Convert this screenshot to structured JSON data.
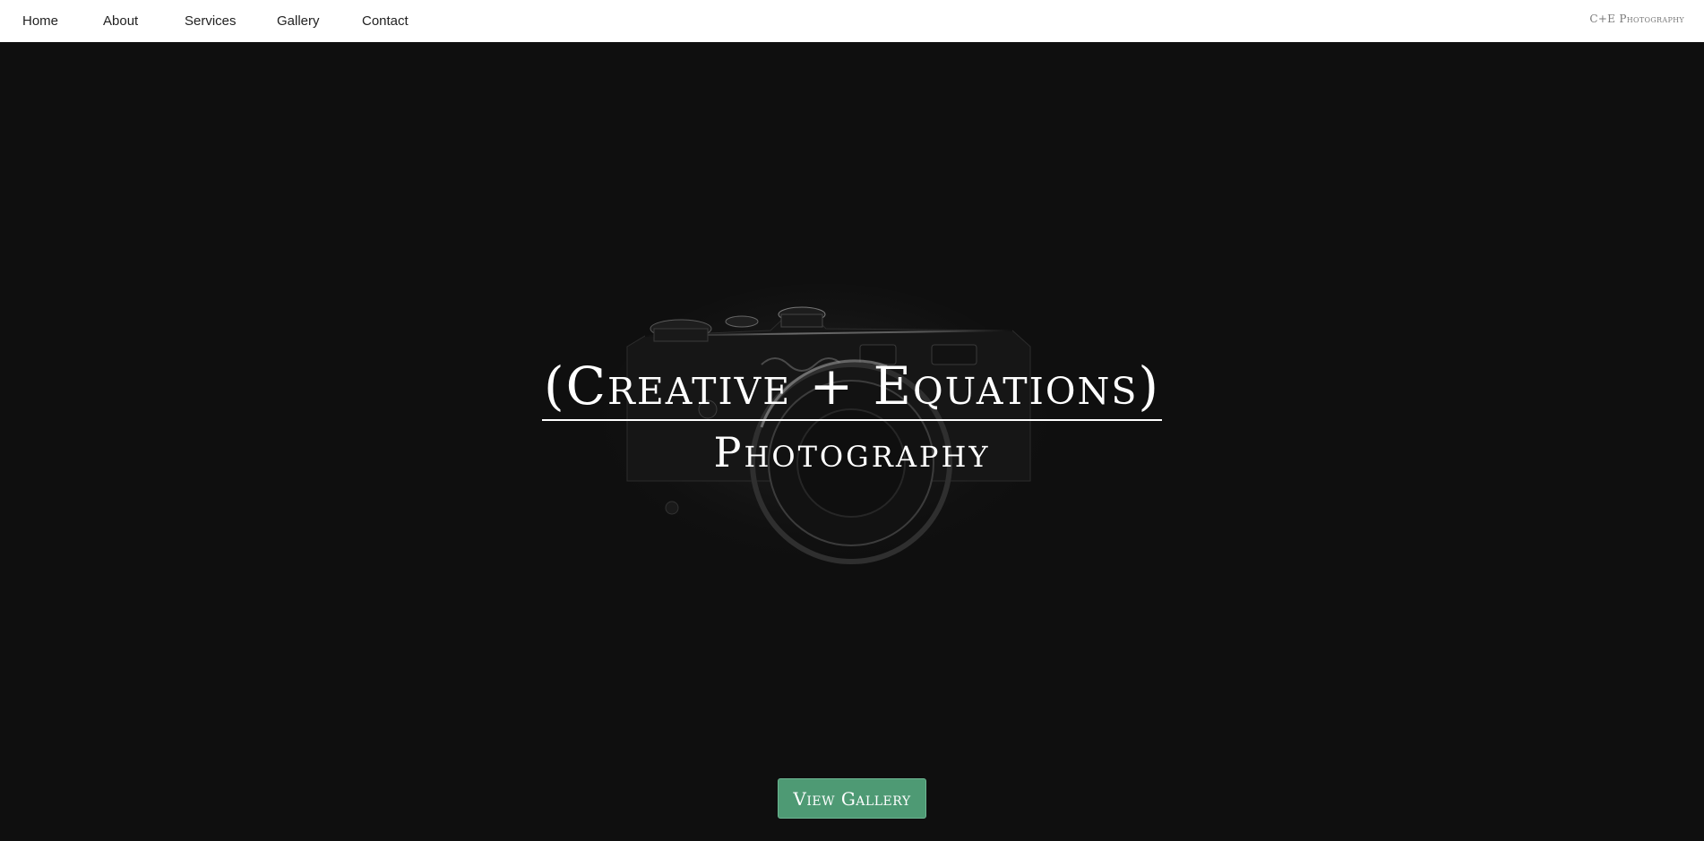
{
  "nav": {
    "links": [
      {
        "label": "Home"
      },
      {
        "label": "About"
      },
      {
        "label": "Services"
      },
      {
        "label": "Gallery"
      },
      {
        "label": "Contact"
      }
    ],
    "brand": "C+E Photography"
  },
  "hero": {
    "title": "(Creative + Equations)",
    "subtitle": "Photography",
    "background_image": "camera-photo"
  },
  "cta": {
    "label": "View Gallery"
  },
  "colors": {
    "nav_background": "#ffffff",
    "hero_background": "#0f0f0f",
    "button_background": "#4e9a74",
    "text_light": "#ffffff"
  }
}
